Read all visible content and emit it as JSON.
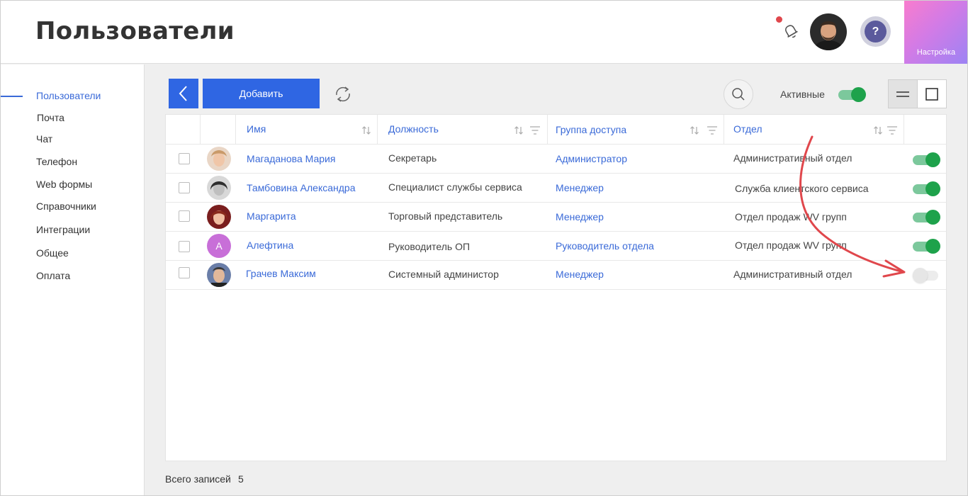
{
  "header": {
    "title": "Пользователи",
    "settings_label": "Настройка",
    "help_symbol": "?",
    "icons": [
      "bell-icon",
      "user-avatar",
      "help-icon"
    ]
  },
  "sidebar": {
    "items": [
      {
        "label": "Пользователи",
        "active": true
      },
      {
        "label": "Почта",
        "active": false
      },
      {
        "label": "Чат",
        "active": false
      },
      {
        "label": "Телефон",
        "active": false
      },
      {
        "label": "Web формы",
        "active": false
      },
      {
        "label": "Справочники",
        "active": false
      },
      {
        "label": "Интеграции",
        "active": false
      },
      {
        "label": "Общее",
        "active": false
      },
      {
        "label": "Оплата",
        "active": false
      }
    ]
  },
  "toolbar": {
    "add_label": "Добавить",
    "active_filter_label": "Активные",
    "active_filter_on": true
  },
  "table": {
    "columns": {
      "name": "Имя",
      "position": "Должность",
      "group": "Группа доступа",
      "department": "Отдел"
    },
    "rows": [
      {
        "name": "Магаданова Мария",
        "position": "Секретарь",
        "group": "Администратор",
        "department": "Административный отдел",
        "active": true,
        "avatar_letter": ""
      },
      {
        "name": "Тамбовина Александра",
        "position": "Специалист службы сервиса",
        "group": "Менеджер",
        "department": "Служба клиентского сервиса",
        "active": true,
        "avatar_letter": ""
      },
      {
        "name": "Маргарита",
        "position": "Торговый представитель",
        "group": "Менеджер",
        "department": "Отдел продаж WV групп",
        "active": true,
        "avatar_letter": ""
      },
      {
        "name": "Алефтина",
        "position": "Руководитель ОП",
        "group": "Руководитель отдела",
        "department": "Отдел продаж WV групп",
        "active": true,
        "avatar_letter": "А"
      },
      {
        "name": "Грачев Максим",
        "position": "Системный администор",
        "group": "Менеджер",
        "department": "Административный отдел",
        "active": false,
        "avatar_letter": ""
      }
    ]
  },
  "footer": {
    "total_label": "Всего записей",
    "total_count": "5"
  },
  "colors": {
    "accent": "#2f66e3",
    "link": "#3a6ad8",
    "toggle_on": "#1ea24b",
    "annotation_arrow": "#e0474c"
  }
}
